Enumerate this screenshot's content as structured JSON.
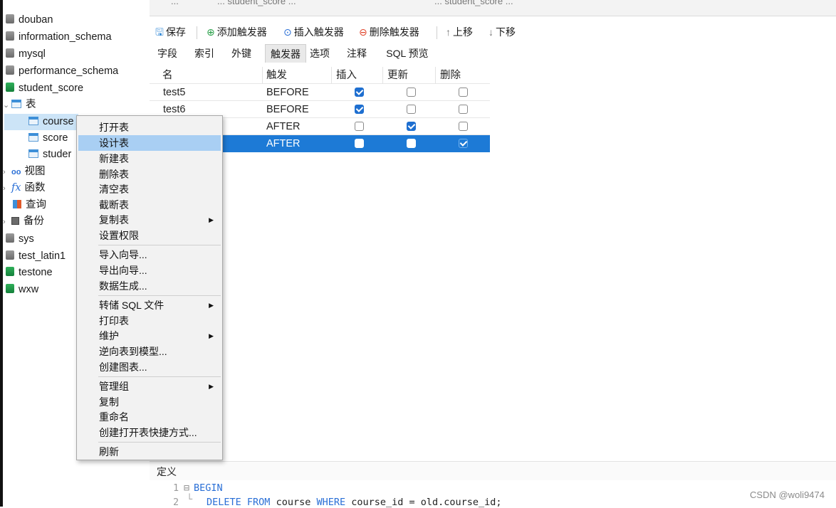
{
  "tabs": [
    "...",
    "... student_score ...",
    "... student_score ..."
  ],
  "tree": {
    "databases_top": [
      "douban",
      "information_schema",
      "mysql",
      "performance_schema"
    ],
    "current_db": "student_score",
    "tables_node": "表",
    "tables": [
      "course",
      "score",
      "studer"
    ],
    "other_nodes": [
      "视图",
      "函数",
      "查询",
      "备份"
    ],
    "databases_bottom": [
      "sys",
      "test_latin1",
      "testone",
      "wxw"
    ]
  },
  "toolbar": {
    "save": "保存",
    "add_trigger": "添加触发器",
    "insert_trigger": "插入触发器",
    "delete_trigger": "删除触发器",
    "move_up": "上移",
    "move_down": "下移"
  },
  "subtabs": [
    "字段",
    "索引",
    "外键",
    "触发器",
    "选项",
    "注释",
    "SQL 预览"
  ],
  "grid": {
    "headers": [
      "名",
      "触发",
      "插入",
      "更新",
      "删除"
    ],
    "rows": [
      {
        "name": "test5",
        "timing": "BEFORE",
        "insert": true,
        "update": false,
        "delete": false
      },
      {
        "name": "test6",
        "timing": "BEFORE",
        "insert": true,
        "update": false,
        "delete": false
      },
      {
        "name": "",
        "timing": "AFTER",
        "insert": false,
        "update": true,
        "delete": false
      },
      {
        "name": "",
        "timing": "AFTER",
        "insert": false,
        "update": false,
        "delete": true
      }
    ]
  },
  "context_menu": {
    "group1": [
      "打开表",
      "设计表",
      "新建表",
      "删除表",
      "清空表",
      "截断表",
      "复制表",
      "设置权限"
    ],
    "group2": [
      "导入向导...",
      "导出向导...",
      "数据生成..."
    ],
    "group3": [
      "转储 SQL 文件",
      "打印表",
      "维护",
      "逆向表到模型...",
      "创建图表..."
    ],
    "group4": [
      "管理组",
      "复制",
      "重命名",
      "创建打开表快捷方式..."
    ],
    "group5": [
      "刷新"
    ],
    "submenu_arrow": "▶"
  },
  "definition": {
    "label": "定义",
    "line1_no": "1",
    "line2_no": "2",
    "begin": "BEGIN",
    "delete_kw": "DELETE",
    "from_kw": "FROM",
    "table": " course ",
    "where_kw": "WHERE",
    "condition": " course_id = old.course_id;"
  },
  "watermark": "CSDN @woli9474",
  "colors": {
    "accent": "#1d7ad6",
    "menu_highlight": "#a9cff3",
    "tree_selected": "#cce4f7",
    "keyword": "#2a6fd6"
  }
}
